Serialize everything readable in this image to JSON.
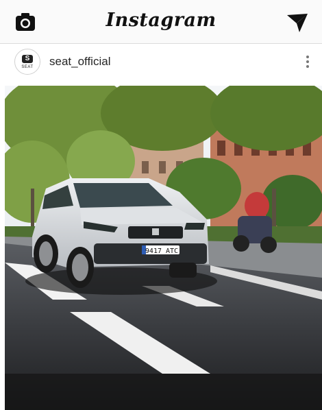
{
  "app": {
    "title": "Instagram"
  },
  "topbar": {
    "left_icon": "camera-icon",
    "right_icon": "send-direct-icon"
  },
  "post": {
    "avatar_mark": "S",
    "avatar_text": "SEAT",
    "username": "seat_official",
    "more_icon": "more-vertical-icon",
    "license_plate": "9417 ATC"
  },
  "colors": {
    "topbar_bg": "#fafafa",
    "text": "#262626"
  }
}
